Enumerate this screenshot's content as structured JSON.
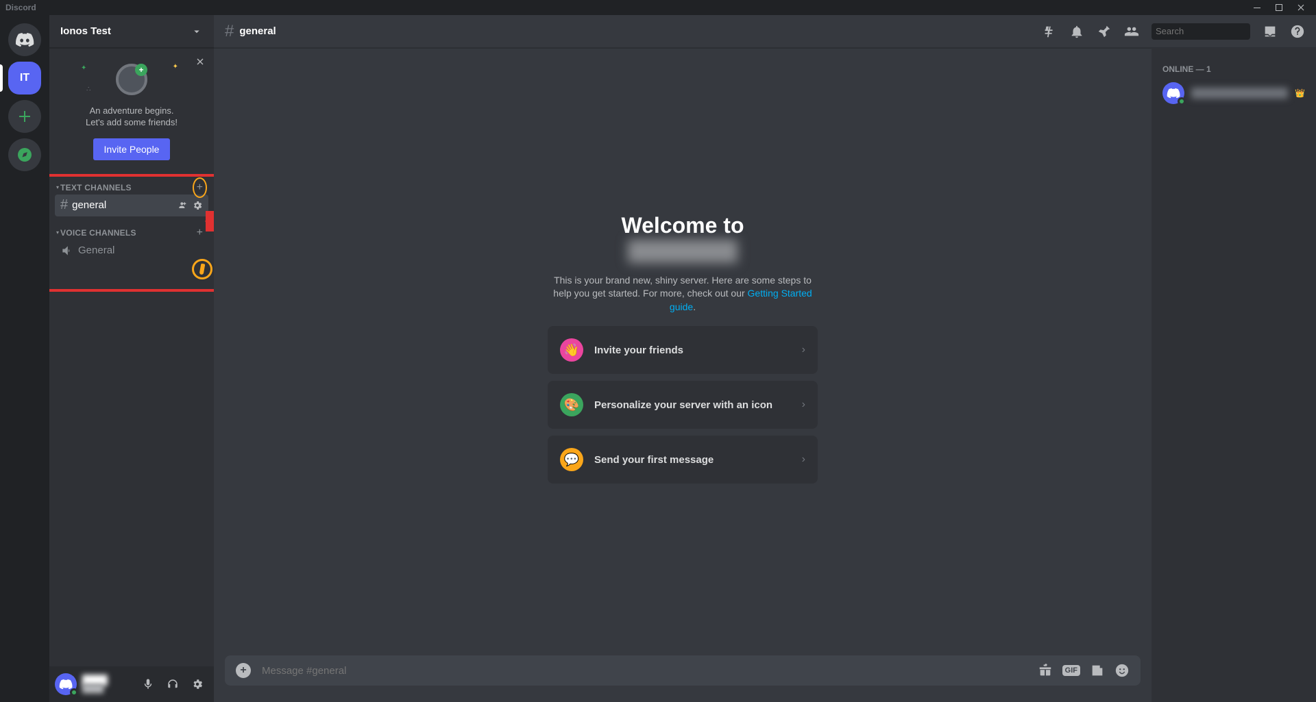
{
  "titlebar": {
    "brand": "Discord"
  },
  "server_rail": {
    "selected_server_initials": "IT"
  },
  "sidebar": {
    "server_name": "Ionos Test",
    "invite": {
      "line1": "An adventure begins.",
      "line2": "Let's add some friends!",
      "button": "Invite People"
    },
    "categories": {
      "text": {
        "label": "TEXT CHANNELS"
      },
      "voice": {
        "label": "VOICE CHANNELS"
      }
    },
    "text_channels": [
      {
        "name": "general"
      }
    ],
    "voice_channels": [
      {
        "name": "General"
      }
    ]
  },
  "header": {
    "channel_name": "general",
    "search_placeholder": "Search"
  },
  "welcome": {
    "title": "Welcome to",
    "sub_prefix": "This is your brand new, shiny server. Here are some steps to help you get started. For more, check out our ",
    "guide_link": "Getting Started guide",
    "period": ".",
    "actions": [
      {
        "label": "Invite your friends"
      },
      {
        "label": "Personalize your server with an icon"
      },
      {
        "label": "Send your first message"
      }
    ]
  },
  "composer": {
    "placeholder": "Message #general"
  },
  "members": {
    "header": "ONLINE — 1"
  }
}
